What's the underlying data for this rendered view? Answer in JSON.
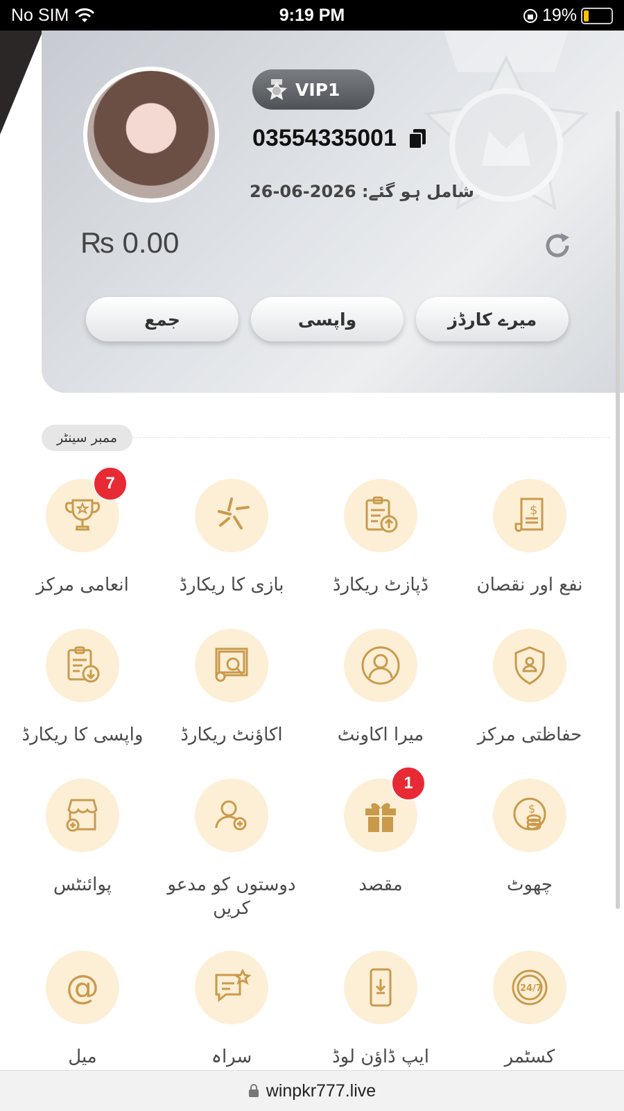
{
  "status_bar": {
    "carrier": "No SIM",
    "time": "9:19 PM",
    "battery": "19%"
  },
  "profile": {
    "vip": "VIP1",
    "uid": "03554335001",
    "joined": "شامل ہو گئے:  2026-06-26",
    "balance": "₨ 0.00"
  },
  "actions": [
    "جمع",
    "واپسی",
    "میرے کارڈز"
  ],
  "section_title": "ممبر سینٹر",
  "menu": [
    {
      "label": "انعامی مرکز",
      "icon": "trophy-icon",
      "badge": "7"
    },
    {
      "label": "بازی کا ریکارڈ",
      "icon": "game-record-icon",
      "badge": ""
    },
    {
      "label": "ڈپازٹ ریکارڈ",
      "icon": "deposit-record-icon",
      "badge": ""
    },
    {
      "label": "نفع اور نقصان",
      "icon": "profit-loss-icon",
      "badge": ""
    },
    {
      "label": "واپسی کا ریکارڈ",
      "icon": "withdraw-record-icon",
      "badge": ""
    },
    {
      "label": "اکاؤنٹ ریکارڈ",
      "icon": "account-record-icon",
      "badge": ""
    },
    {
      "label": "میرا اکاونٹ",
      "icon": "user-icon",
      "badge": ""
    },
    {
      "label": "حفاظتی مرکز",
      "icon": "shield-icon",
      "badge": ""
    },
    {
      "label": "پوائنٹس",
      "icon": "shop-icon",
      "badge": ""
    },
    {
      "label": "دوستوں کو مدعو کریں",
      "icon": "invite-icon",
      "badge": ""
    },
    {
      "label": "مقصد",
      "icon": "gift-icon",
      "badge": "1"
    },
    {
      "label": "چھوٹ",
      "icon": "coins-icon",
      "badge": ""
    },
    {
      "label": "میل",
      "icon": "mail-icon",
      "badge": ""
    },
    {
      "label": "سراہ",
      "icon": "feedback-icon",
      "badge": ""
    },
    {
      "label": "ایپ ڈاؤن لوڈ",
      "icon": "download-icon",
      "badge": ""
    },
    {
      "label": "کسٹمر",
      "icon": "support-24-7-icon",
      "badge": ""
    }
  ],
  "url": "winpkr777.live"
}
